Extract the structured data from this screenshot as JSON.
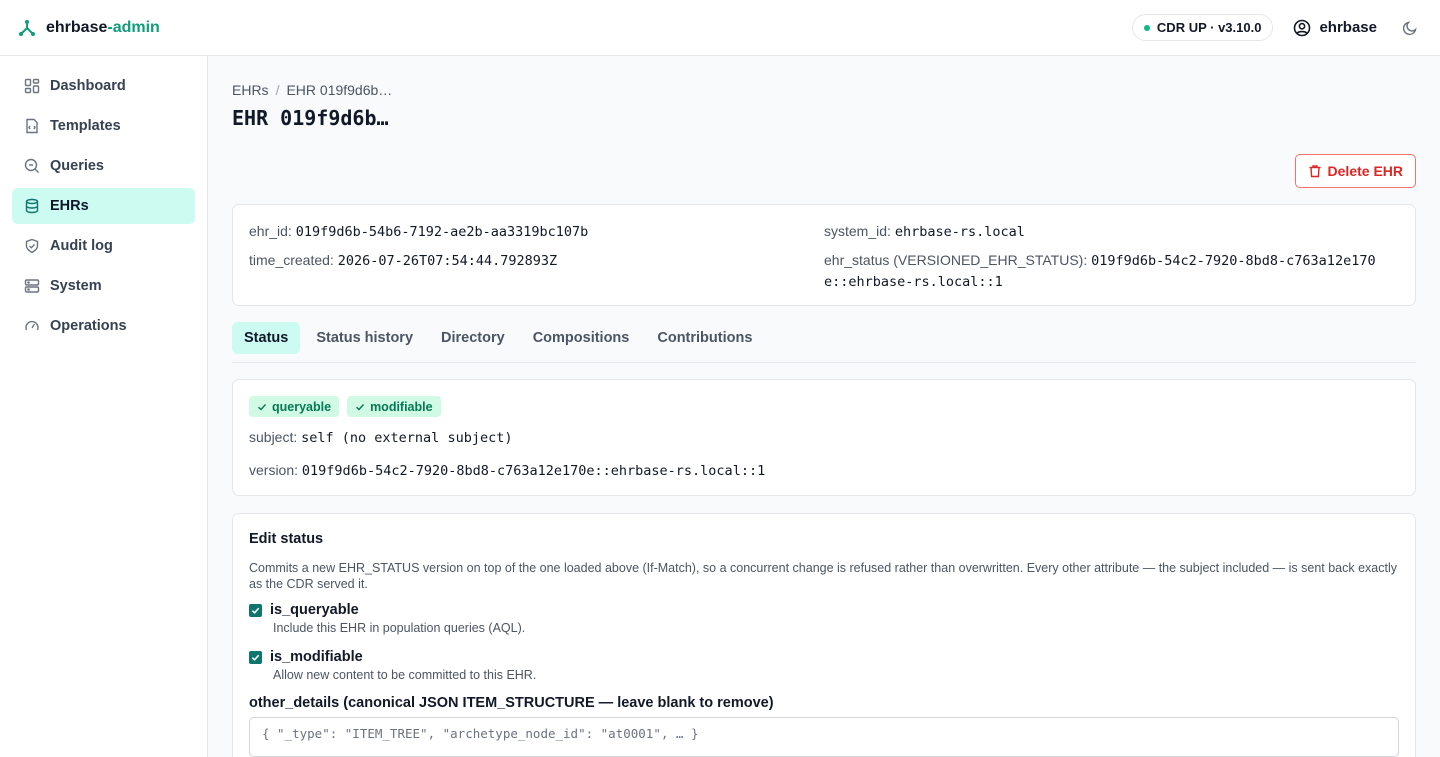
{
  "brand": {
    "name": "ehrbase",
    "separator": "-",
    "suffix": "admin"
  },
  "header": {
    "cdr_status": "CDR UP · v3.10.0",
    "username": "ehrbase"
  },
  "sidebar": {
    "items": [
      {
        "label": "Dashboard",
        "icon": "dashboard-icon",
        "active": false
      },
      {
        "label": "Templates",
        "icon": "templates-icon",
        "active": false
      },
      {
        "label": "Queries",
        "icon": "queries-icon",
        "active": false
      },
      {
        "label": "EHRs",
        "icon": "database-icon",
        "active": true
      },
      {
        "label": "Audit log",
        "icon": "shield-icon",
        "active": false
      },
      {
        "label": "System",
        "icon": "server-icon",
        "active": false
      },
      {
        "label": "Operations",
        "icon": "gauge-icon",
        "active": false
      }
    ]
  },
  "breadcrumb": {
    "root": "EHRs",
    "separator": "/",
    "current": "EHR 019f9d6b…"
  },
  "page": {
    "title": "EHR 019f9d6b…",
    "delete_label": "Delete EHR"
  },
  "info": {
    "ehr_id_label": "ehr_id:",
    "ehr_id": "019f9d6b-54b6-7192-ae2b-aa3319bc107b",
    "time_created_label": "time_created:",
    "time_created": "2026-07-26T07:54:44.792893Z",
    "system_id_label": "system_id:",
    "system_id": "ehrbase-rs.local",
    "ehr_status_label": "ehr_status (VERSIONED_EHR_STATUS):",
    "ehr_status": "019f9d6b-54c2-7920-8bd8-c763a12e170e::ehrbase-rs.local::1"
  },
  "tabs": [
    "Status",
    "Status history",
    "Directory",
    "Compositions",
    "Contributions"
  ],
  "status": {
    "badges": [
      "queryable",
      "modifiable"
    ],
    "subject_label": "subject:",
    "subject": "self (no external subject)",
    "version_label": "version:",
    "version": "019f9d6b-54c2-7920-8bd8-c763a12e170e::ehrbase-rs.local::1"
  },
  "edit": {
    "title": "Edit status",
    "description": "Commits a new EHR_STATUS version on top of the one loaded above (If-Match), so a concurrent change is refused rather than overwritten. Every other attribute — the subject included — is sent back exactly as the CDR served it.",
    "queryable_label": "is_queryable",
    "queryable_help": "Include this EHR in population queries (AQL).",
    "queryable_checked": true,
    "modifiable_label": "is_modifiable",
    "modifiable_help": "Allow new content to be committed to this EHR.",
    "modifiable_checked": true,
    "other_details_label": "other_details (canonical JSON ITEM_STRUCTURE — leave blank to remove)",
    "other_details_placeholder": "{ \"_type\": \"ITEM_TREE\", \"archetype_node_id\": \"at0001\", … }"
  },
  "colors": {
    "accent": "#0f9d7a",
    "active_bg": "#ccfbf1",
    "danger": "#dc2626",
    "badge_bg": "#d1fae5"
  }
}
